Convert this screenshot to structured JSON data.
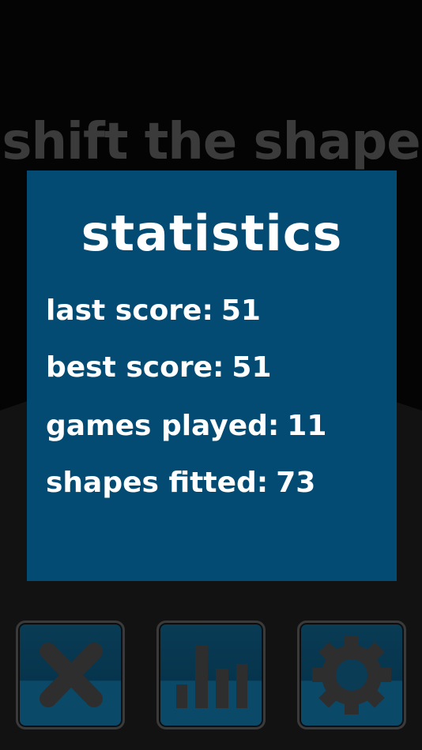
{
  "game": {
    "title": "shift the shape"
  },
  "statistics": {
    "heading": "statistics",
    "rows": [
      {
        "label": "last score:",
        "value": "51"
      },
      {
        "label": "best score:",
        "value": "51"
      },
      {
        "label": "games played:",
        "value": "11"
      },
      {
        "label": "shapes fitted:",
        "value": "73"
      }
    ]
  },
  "buttons": {
    "close": {
      "icon": "close-x-icon"
    },
    "stats": {
      "icon": "bar-chart-icon"
    },
    "settings": {
      "icon": "gear-icon"
    }
  },
  "colors": {
    "background": "#040404",
    "panel": "#034b72",
    "title": "#3b3b3b",
    "button_face": "#0a3c55",
    "icon": "#2e2e2e"
  }
}
